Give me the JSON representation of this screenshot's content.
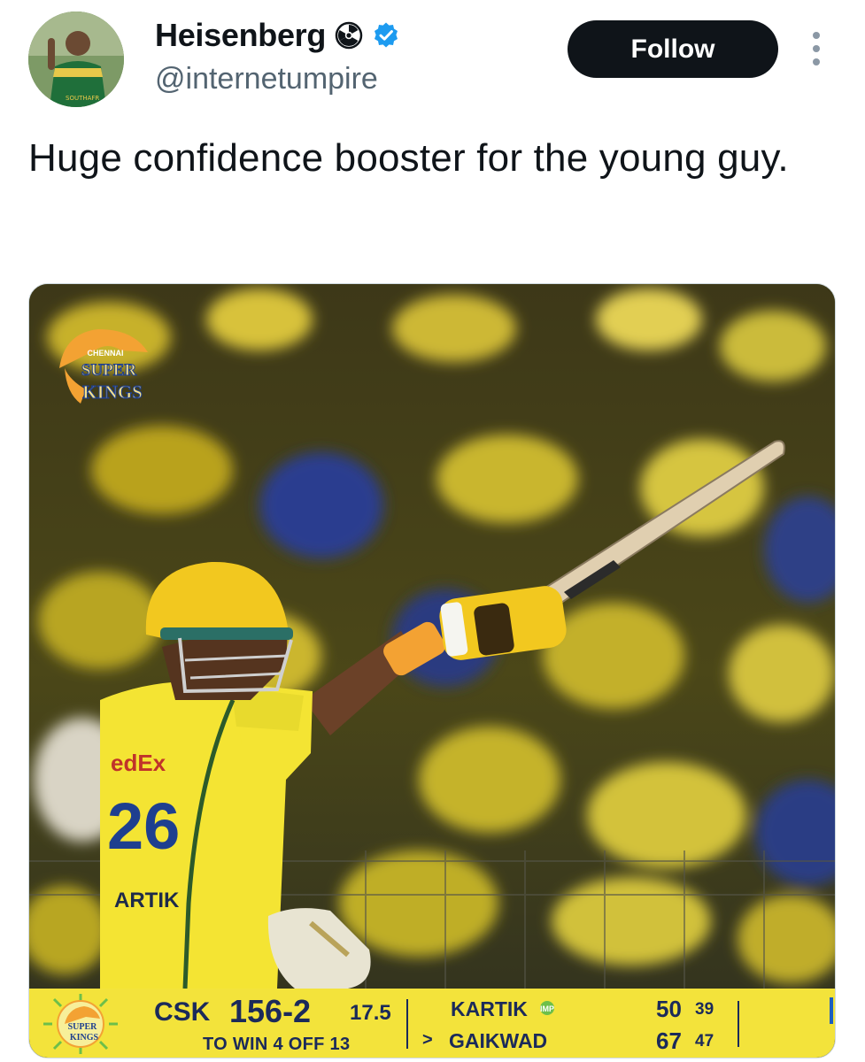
{
  "author": {
    "display_name": "Heisenberg",
    "handle": "@internetumpire",
    "name_emoji": "radioactive-icon",
    "verified": true,
    "avatar_shirt_text": "SOUTHAFR"
  },
  "actions": {
    "follow_label": "Follow",
    "more_icon": "more-vertical-icon"
  },
  "tweet": {
    "text": "Huge confidence booster for the young guy."
  },
  "media": {
    "team_logo_lines": [
      "CHENNAI",
      "SUPER",
      "KINGS"
    ],
    "jersey_sponsor": "edEx",
    "jersey_number": "26",
    "jersey_name": "ARTIK",
    "scorebar": {
      "team": "CSK",
      "score": "156-2",
      "overs": "17.5",
      "target": "TO WIN 4 OFF 13",
      "striker": "KARTIK",
      "striker_badge": "IMP",
      "striker_runs": "50",
      "striker_balls": "39",
      "non_striker_marker": ">",
      "non_striker": "GAIKWAD",
      "non_striker_runs": "67",
      "non_striker_balls": "47"
    }
  },
  "colors": {
    "follow_bg": "#0f1419",
    "verified_blue": "#1d9bf0",
    "csk_yellow": "#f3e33b",
    "score_navy": "#1b2a5a",
    "handle_gray": "#536471"
  }
}
